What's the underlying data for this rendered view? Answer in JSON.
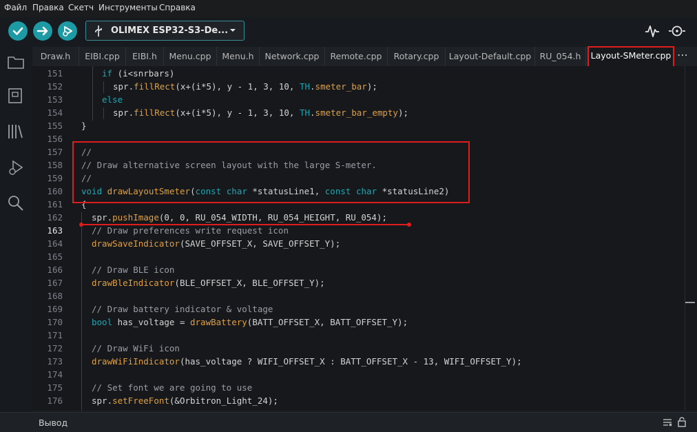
{
  "menu": [
    "Файл",
    "Правка",
    "Скетч",
    "Инструменты",
    "Справка"
  ],
  "toolbar": {
    "board_name": "OLIMEX ESP32-S3-De...",
    "icons": [
      "verify-icon",
      "upload-icon",
      "debug-icon",
      "serial-plotter-icon",
      "serial-monitor-icon"
    ]
  },
  "activity_icons": [
    "folder-icon",
    "boards-manager-icon",
    "library-icon",
    "debug-icon",
    "search-icon"
  ],
  "tabs": [
    "Draw.h",
    "EIBI.cpp",
    "EIBI.h",
    "Menu.cpp",
    "Menu.h",
    "Network.cpp",
    "Remote.cpp",
    "Rotary.cpp",
    "Layout-Default.cpp",
    "RU_054.h",
    "Layout-SMeter.cpp"
  ],
  "active_tab": "Layout-SMeter.cpp",
  "more_label": "⋯",
  "current_line": 163,
  "lines": [
    {
      "n": "151",
      "text": "if (i<snrbars)"
    },
    {
      "n": "152",
      "text": "spr.fillRect(x+(i*5), y - 1, 3, 10, TH.smeter_bar);"
    },
    {
      "n": "153",
      "text": "else"
    },
    {
      "n": "154",
      "text": "spr.fillRect(x+(i*5), y - 1, 3, 10, TH.smeter_bar_empty);"
    },
    {
      "n": "155",
      "text": "}"
    },
    {
      "n": "156",
      "text": ""
    },
    {
      "n": "157",
      "text": "//"
    },
    {
      "n": "158",
      "text": "// Draw alternative screen layout with the large S-meter."
    },
    {
      "n": "159",
      "text": "//"
    },
    {
      "n": "160",
      "text": "void drawLayoutSmeter(const char *statusLine1, const char *statusLine2)"
    },
    {
      "n": "161",
      "text": "{"
    },
    {
      "n": "162",
      "text": "spr.pushImage(0, 0, RU_054_WIDTH, RU_054_HEIGHT, RU_054);"
    },
    {
      "n": "163",
      "text": "// Draw preferences write request icon"
    },
    {
      "n": "164",
      "text": "drawSaveIndicator(SAVE_OFFSET_X, SAVE_OFFSET_Y);"
    },
    {
      "n": "165",
      "text": ""
    },
    {
      "n": "166",
      "text": "// Draw BLE icon"
    },
    {
      "n": "167",
      "text": "drawBleIndicator(BLE_OFFSET_X, BLE_OFFSET_Y);"
    },
    {
      "n": "168",
      "text": ""
    },
    {
      "n": "169",
      "text": "// Draw battery indicator & voltage"
    },
    {
      "n": "170",
      "text": "bool has_voltage = drawBattery(BATT_OFFSET_X, BATT_OFFSET_Y);"
    },
    {
      "n": "171",
      "text": ""
    },
    {
      "n": "172",
      "text": "// Draw WiFi icon"
    },
    {
      "n": "173",
      "text": "drawWiFiIndicator(has_voltage ? WIFI_OFFSET_X : BATT_OFFSET_X - 13, WIFI_OFFSET_Y);"
    },
    {
      "n": "174",
      "text": ""
    },
    {
      "n": "175",
      "text": "// Set font we are going to use"
    },
    {
      "n": "176",
      "text": "spr.setFreeFont(&Orbitron_Light_24);"
    }
  ],
  "output": {
    "label": "Вывод",
    "icons": [
      "clear-output-icon",
      "lock-icon"
    ]
  },
  "colors": {
    "accent": "#1d9aa3",
    "highlight": "#e01d1d",
    "keyword": "#1ea7b3",
    "function": "#e0a040",
    "comment": "#9a9ea5"
  }
}
